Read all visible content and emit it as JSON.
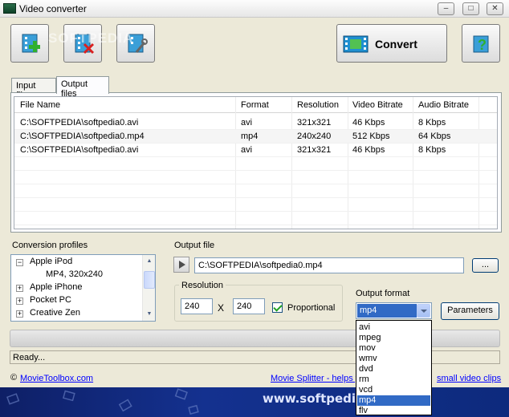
{
  "window": {
    "title": "Video converter",
    "minimize_glyph": "–",
    "maximize_glyph": "□",
    "close_glyph": "✕"
  },
  "toolbar": {
    "add_icon": "add-file-icon",
    "remove_icon": "remove-file-icon",
    "settings_icon": "settings-tools-icon",
    "convert_label": "Convert",
    "help_icon": "help-icon"
  },
  "watermark": "SOFTPEDIA",
  "tabs": [
    {
      "label": "Input files",
      "active": false
    },
    {
      "label": "Output files",
      "active": true
    }
  ],
  "table": {
    "headers": [
      "File Name",
      "Format",
      "Resolution",
      "Video Bitrate",
      "Audio Bitrate"
    ],
    "rows": [
      [
        "C:\\SOFTPEDIA\\softpedia0.avi",
        "avi",
        "321x321",
        "46 Kbps",
        "8 Kbps"
      ],
      [
        "C:\\SOFTPEDIA\\softpedia0.mp4",
        "mp4",
        "240x240",
        "512 Kbps",
        "64 Kbps"
      ],
      [
        "C:\\SOFTPEDIA\\softpedia0.avi",
        "avi",
        "321x321",
        "46 Kbps",
        "8 Kbps"
      ]
    ]
  },
  "profiles": {
    "label": "Conversion profiles",
    "items": [
      {
        "label": "Apple iPod",
        "expander": "−"
      },
      {
        "label": "MP4, 320x240",
        "expander": ""
      },
      {
        "label": "Apple iPhone",
        "expander": "+"
      },
      {
        "label": "Pocket PC",
        "expander": "+"
      },
      {
        "label": "Creative Zen",
        "expander": "+"
      }
    ]
  },
  "output_file": {
    "label": "Output file",
    "path": "C:\\SOFTPEDIA\\softpedia0.mp4",
    "browse_label": "..."
  },
  "resolution": {
    "label": "Resolution",
    "width": "240",
    "separator": "X",
    "height": "240",
    "proportional_label": "Proportional",
    "proportional_checked": true
  },
  "output_format": {
    "label": "Output format",
    "selected": "mp4",
    "options": [
      "avi",
      "mpeg",
      "mov",
      "wmv",
      "dvd",
      "rm",
      "vcd",
      "mp4",
      "flv"
    ]
  },
  "parameters_label": "Parameters",
  "status": "Ready...",
  "footer": {
    "copyright": "©",
    "link_left": "MovieToolbox.com",
    "link_right_a": "Movie Splitter - helps y",
    "link_right_b": "small video clips"
  },
  "banner_text": "www.softpedia.co"
}
